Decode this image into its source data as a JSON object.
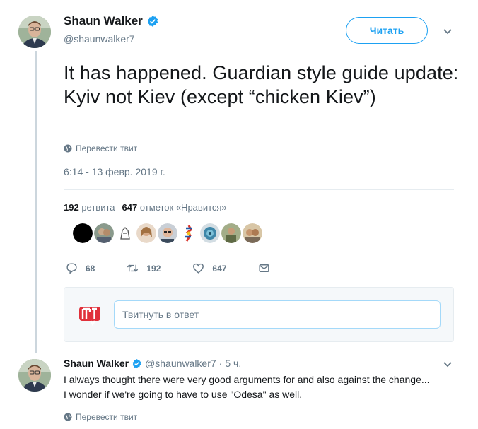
{
  "tweet": {
    "author_name": "Shaun Walker",
    "author_handle": "@shaunwalker7",
    "follow_label": "Читать",
    "text": "It has happened. Guardian style guide update: Kyiv not Kiev (except “chicken Kiev”)",
    "translate_label": "Перевести твит",
    "timestamp": "6:14 - 13 февр. 2019 г."
  },
  "stats": {
    "retweets_count": "192",
    "retweets_label": "ретвита",
    "likes_count": "647",
    "likes_label": "отметок «Нравится»"
  },
  "actions": {
    "replies": "68",
    "retweets": "192",
    "likes": "647"
  },
  "reply_box": {
    "placeholder": "Твитнуть в ответ"
  },
  "reply": {
    "author_name": "Shaun Walker",
    "author_handle": "@shaunwalker7",
    "separator": "·",
    "time": "5 ч.",
    "text": "I always thought there were very good arguments for and also against the change... I wonder if we're going to have to use \"Odesa\" as well.",
    "translate_label": "Перевести твит"
  },
  "colors": {
    "brand_blue": "#1da1f2",
    "muted": "#657786",
    "text": "#14171a",
    "reply_logo_red": "#e0303a"
  },
  "icons": {
    "verified": "verified-badge-icon",
    "caret": "chevron-down-icon",
    "translate": "globe-icon",
    "reply": "reply-icon",
    "retweet": "retweet-icon",
    "like": "heart-icon",
    "dm": "envelope-icon"
  }
}
